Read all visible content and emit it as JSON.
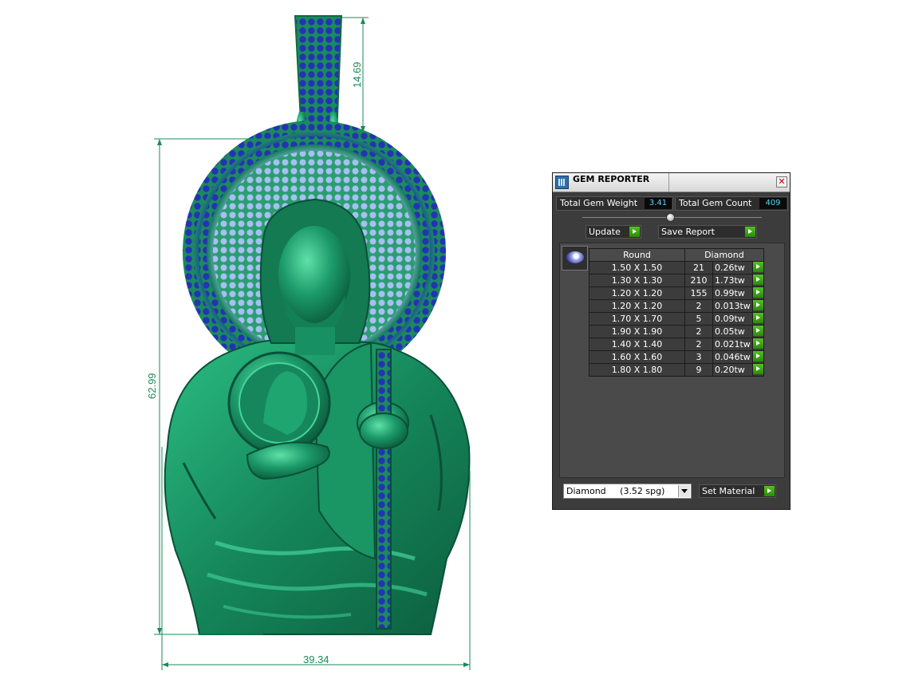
{
  "viewport": {
    "dimensions": {
      "bail_height": "14.69",
      "pendant_height": "62.99",
      "pendant_width": "39.34"
    }
  },
  "gem_reporter": {
    "title": "GEM REPORTER",
    "close_symbol": "✕",
    "total_weight_label": "Total Gem Weight",
    "total_weight_value": "3.41",
    "total_count_label": "Total Gem Count",
    "total_count_value": "409",
    "update_label": "Update",
    "save_report_label": "Save Report",
    "table": {
      "headers": [
        "Round",
        "Diamond"
      ],
      "rows": [
        {
          "size": "1.50 X 1.50",
          "count": "21",
          "weight": "0.26tw"
        },
        {
          "size": "1.30 X 1.30",
          "count": "210",
          "weight": "1.73tw"
        },
        {
          "size": "1.20 X 1.20",
          "count": "155",
          "weight": "0.99tw"
        },
        {
          "size": "1.20 X 1.20",
          "count": "2",
          "weight": "0.013tw"
        },
        {
          "size": "1.70 X 1.70",
          "count": "5",
          "weight": "0.09tw"
        },
        {
          "size": "1.90 X 1.90",
          "count": "2",
          "weight": "0.05tw"
        },
        {
          "size": "1.40 X 1.40",
          "count": "2",
          "weight": "0.021tw"
        },
        {
          "size": "1.60 X 1.60",
          "count": "3",
          "weight": "0.046tw"
        },
        {
          "size": "1.80 X 1.80",
          "count": "9",
          "weight": "0.20tw"
        }
      ]
    },
    "material_select": "Diamond     (3.52 spg)",
    "set_material_label": "Set Material"
  },
  "colors": {
    "metal": "#1c9a6a",
    "gem_blue": "#2230b0",
    "gem_light": "#9fb8f0",
    "dim_line": "#1a8a5a",
    "panel_bg": "#3c3c3c",
    "value_text": "#5ad3ff",
    "accent_green": "#3aa812"
  }
}
